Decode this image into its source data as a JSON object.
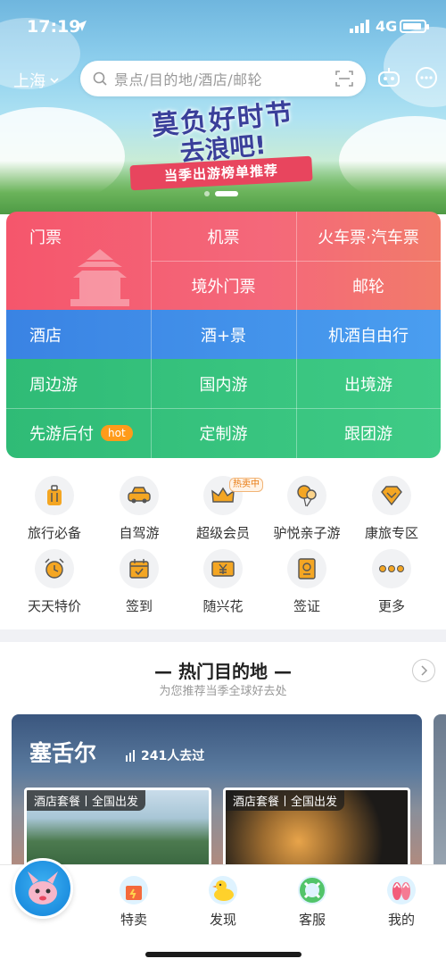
{
  "status_bar": {
    "time": "17:19",
    "network": "4G"
  },
  "header": {
    "city": "上海",
    "search_placeholder": "景点/目的地/酒店/邮轮"
  },
  "banner": {
    "line1": "莫负好时节",
    "line2": "去浪吧!",
    "ribbon": "当季出游榜单推荐"
  },
  "grid": {
    "row1": [
      "门票",
      "机票",
      "火车票·汽车票"
    ],
    "row2": [
      "境外门票",
      "邮轮"
    ],
    "row3": [
      "酒店",
      "酒+景",
      "机酒自由行"
    ],
    "row4": [
      "周边游",
      "国内游",
      "出境游"
    ],
    "row5": [
      "先游后付",
      "定制游",
      "跟团游"
    ],
    "hot_badge": "hot",
    "colors": {
      "red": "#f2566a",
      "blue": "#3f8fea",
      "green": "#34c27c"
    }
  },
  "icons": {
    "row1": [
      {
        "label": "旅行必备",
        "icon": "luggage-icon"
      },
      {
        "label": "自驾游",
        "icon": "car-icon"
      },
      {
        "label": "超级会员",
        "icon": "crown-icon"
      },
      {
        "label": "驴悦亲子游",
        "icon": "balloon-icon"
      },
      {
        "label": "康旅专区",
        "icon": "diamond-icon"
      }
    ],
    "row2": [
      {
        "label": "天天特价",
        "icon": "alarm-clock-icon"
      },
      {
        "label": "签到",
        "icon": "calendar-check-icon"
      },
      {
        "label": "随兴花",
        "icon": "yen-card-icon"
      },
      {
        "label": "签证",
        "icon": "passport-icon"
      },
      {
        "label": "更多",
        "icon": "more-dots-icon"
      }
    ],
    "hot_sale_badge": "热卖中"
  },
  "hot_destinations": {
    "title": "— 热门目的地 —",
    "subtitle": "为您推荐当季全球好去处",
    "card": {
      "name": "塞舌尔",
      "visits": "241人去过",
      "packages": [
        "酒店套餐丨全国出发",
        "酒店套餐丨全国出发"
      ]
    }
  },
  "tabbar": [
    "特卖",
    "发现",
    "客服",
    "我的"
  ]
}
